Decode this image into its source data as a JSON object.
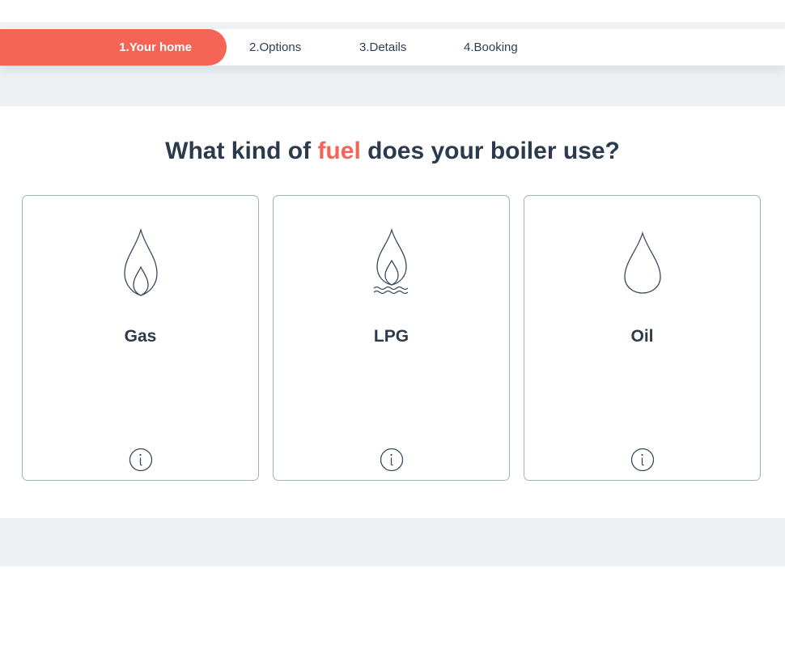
{
  "steps": [
    {
      "label": "1.Your home",
      "active": true
    },
    {
      "label": "2.Options",
      "active": false
    },
    {
      "label": "3.Details",
      "active": false
    },
    {
      "label": "4.Booking",
      "active": false
    }
  ],
  "question": {
    "before": "What kind of ",
    "highlight": "fuel",
    "after": " does your boiler use?"
  },
  "options": [
    {
      "label": "Gas",
      "icon": "flame-icon"
    },
    {
      "label": "LPG",
      "icon": "flame-over-liquid-icon"
    },
    {
      "label": "Oil",
      "icon": "droplet-icon"
    }
  ],
  "colors": {
    "accent": "#f66357",
    "text": "#2b3a4c",
    "card_border": "#9fb3c6",
    "band": "#eef1f4"
  }
}
